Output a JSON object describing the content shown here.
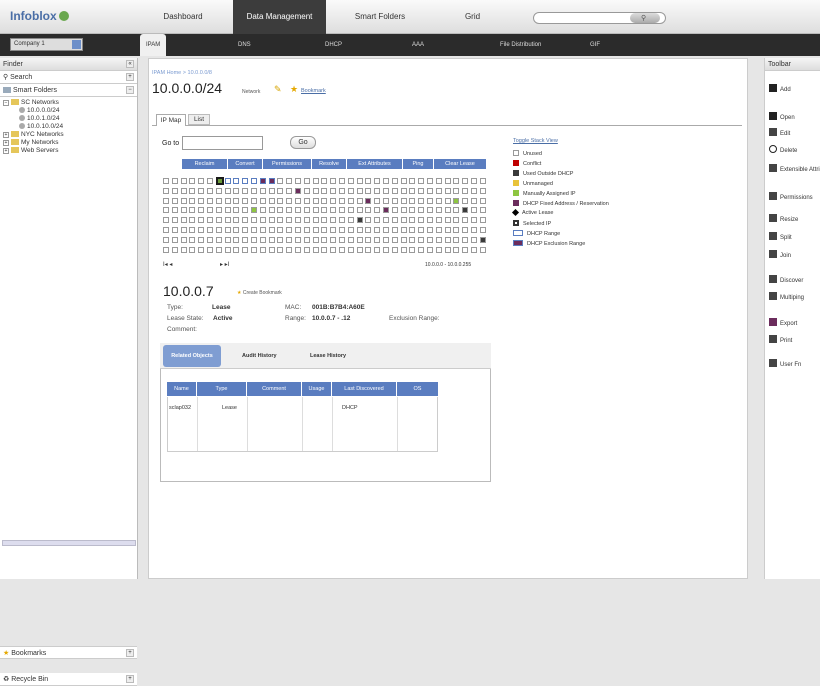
{
  "app": {
    "logo": "Infoblox",
    "nav": [
      "Dashboard",
      "Data Management",
      "Smart Folders",
      "Grid"
    ],
    "company": "Company 1",
    "subtabs": [
      "IPAM",
      "DNS",
      "DHCP",
      "AAA",
      "File Distribution",
      "GIF"
    ]
  },
  "finder": {
    "title": "Finder",
    "search": "Search",
    "smart_folders": "Smart Folders",
    "tree": [
      {
        "label": "SC Networks",
        "level": 0
      },
      {
        "label": "10.0.0.0/24",
        "level": 1
      },
      {
        "label": "10.0.1.0/24",
        "level": 1
      },
      {
        "label": "10.0.10.0/24",
        "level": 1
      },
      {
        "label": "NYC Networks",
        "level": 0
      },
      {
        "label": "My Networks",
        "level": 0
      },
      {
        "label": "Web Servers",
        "level": 0
      }
    ],
    "bookmarks": "Bookmarks",
    "recycle": "Recycle Bin"
  },
  "main": {
    "breadcrumb": "IPAM Home > 10.0.0.0/8",
    "title": "10.0.0.0/24",
    "title_sub": "Network",
    "bookmark": "Bookmark",
    "tabs": [
      "IP Map",
      "List"
    ],
    "goto_label": "Go to",
    "go_btn": "Go",
    "actions": [
      "Reclaim",
      "Convert",
      "Permissions",
      "Resolve",
      "Ext Attributes",
      "Ping",
      "Clear Lease"
    ],
    "pager_first": "I◂ ◂",
    "pager_next": "▸ ▸I",
    "range_label": "10.0.0.0 - 10.0.0.255",
    "grid": {
      "rows": 8,
      "cols": 37,
      "marks": [
        {
          "r": 0,
          "c": 6,
          "t": "selected"
        },
        {
          "r": 0,
          "c": 7,
          "t": "range"
        },
        {
          "r": 0,
          "c": 8,
          "t": "range"
        },
        {
          "r": 0,
          "c": 9,
          "t": "range"
        },
        {
          "r": 0,
          "c": 10,
          "t": "range"
        },
        {
          "r": 0,
          "c": 11,
          "t": "excl"
        },
        {
          "r": 0,
          "c": 12,
          "t": "excl"
        },
        {
          "r": 1,
          "c": 15,
          "t": "fixed"
        },
        {
          "r": 2,
          "c": 23,
          "t": "fixed"
        },
        {
          "r": 2,
          "c": 33,
          "t": "managed"
        },
        {
          "r": 3,
          "c": 10,
          "t": "managed"
        },
        {
          "r": 3,
          "c": 25,
          "t": "fixed"
        },
        {
          "r": 3,
          "c": 34,
          "t": "used"
        },
        {
          "r": 4,
          "c": 22,
          "t": "used"
        },
        {
          "r": 6,
          "c": 36,
          "t": "used"
        }
      ]
    },
    "toggle": "Toggle Stack View",
    "legend": [
      {
        "label": "Unused",
        "color": "#ffffff"
      },
      {
        "label": "Conflict",
        "color": "#c00000"
      },
      {
        "label": "Used Outside DHCP",
        "color": "#3a3a3a"
      },
      {
        "label": "Unmanaged",
        "color": "#e8c33a"
      },
      {
        "label": "Manually Assigned IP",
        "color": "#8ec641"
      },
      {
        "label": "DHCP Fixed Address / Reservation",
        "color": "#6b2c5c"
      },
      {
        "label": "Active Lease",
        "color": "#000000"
      },
      {
        "label": "Selected IP",
        "color": "#ffffff"
      },
      {
        "label": "DHCP Range",
        "color": "#ffffff"
      },
      {
        "label": "DHCP Exclusion Range",
        "color": "#ffffff"
      }
    ],
    "detail": {
      "ip": "10.0.0.7",
      "create_bm": "Create Bookmark",
      "type_label": "Type:",
      "type_val": "Lease",
      "mac_label": "MAC:",
      "mac_val": "001B:B7B4:A60E",
      "state_label": "Lease State:",
      "state_val": "Active",
      "range_label": "Range:",
      "range_val": "10.0.0.7 - .12",
      "excl_label": "Exclusion Range:",
      "comment_label": "Comment:"
    },
    "subtabs": [
      "Related Objects",
      "Audit History",
      "Lease History"
    ],
    "table": {
      "headers": [
        "Name",
        "Type",
        "Comment",
        "Usage",
        "Last Discovered",
        "OS"
      ],
      "rows": [
        [
          "sclap032",
          "Lease",
          "",
          "DHCP",
          "",
          ""
        ]
      ]
    }
  },
  "toolbar": {
    "title": "Toolbar",
    "items": [
      "Add",
      "Open",
      "Edit",
      "Delete",
      "Extensible Attributes",
      "Permissions",
      "Resize",
      "Split",
      "Join",
      "Discover",
      "Multiping",
      "Export",
      "Print",
      "User Fn"
    ]
  }
}
